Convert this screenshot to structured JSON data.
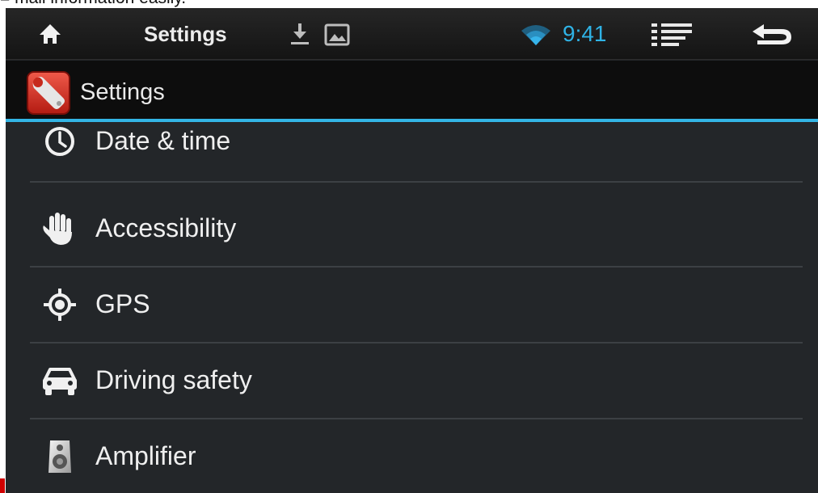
{
  "document": {
    "caption_fragment": "= mail information easily."
  },
  "statusbar": {
    "title": "Settings",
    "clock": "9:41",
    "icons": [
      "home-icon",
      "download-icon",
      "picture-icon",
      "wifi-icon",
      "menu-icon",
      "back-icon"
    ],
    "clock_color": "#2fb3e6"
  },
  "actionbar": {
    "title": "Settings",
    "app_icon": "settings-wrench-icon",
    "accent_color": "#33b5e5"
  },
  "settings_list": [
    {
      "label": "Date & time",
      "icon": "clock-icon"
    },
    {
      "label": "Accessibility",
      "icon": "hand-icon"
    },
    {
      "label": "GPS",
      "icon": "gps-target-icon"
    },
    {
      "label": "Driving safety",
      "icon": "car-icon"
    },
    {
      "label": "Amplifier",
      "icon": "speaker-icon"
    }
  ]
}
